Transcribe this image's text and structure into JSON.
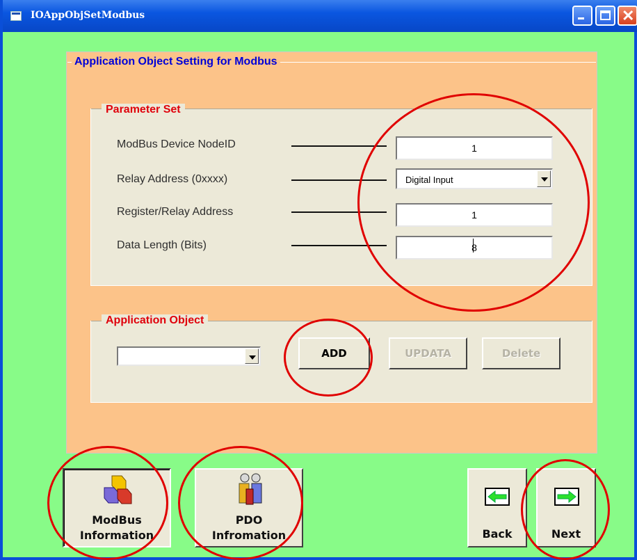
{
  "window": {
    "title": "IOAppObjSetModbus"
  },
  "main": {
    "frame_title": "Application Object Setting for Modbus",
    "parameter_set": {
      "title": "Parameter Set",
      "rows": [
        {
          "label": "ModBus Device NodeID",
          "value": "1"
        },
        {
          "label": "Relay Address (0xxxx)",
          "value": "Digital Input"
        },
        {
          "label": "Register/Relay Address",
          "value": "1"
        },
        {
          "label": "Data Length (Bits)",
          "value": "8"
        }
      ]
    },
    "application_object": {
      "title": "Application Object",
      "selected": "",
      "add_label": "ADD",
      "update_label": "UPDATA",
      "delete_label": "Delete"
    }
  },
  "bottom": {
    "modbus_line1": "ModBus",
    "modbus_line2": "Information",
    "pdo_line1": "PDO",
    "pdo_line2": "Infromation",
    "back_label": "Back",
    "next_label": "Next"
  },
  "colors": {
    "window_bg": "#88fb88",
    "frame_bg": "#fcc389",
    "frame_title": "#0000d8",
    "group_title": "#e0000b",
    "highlight": "#e00000"
  }
}
